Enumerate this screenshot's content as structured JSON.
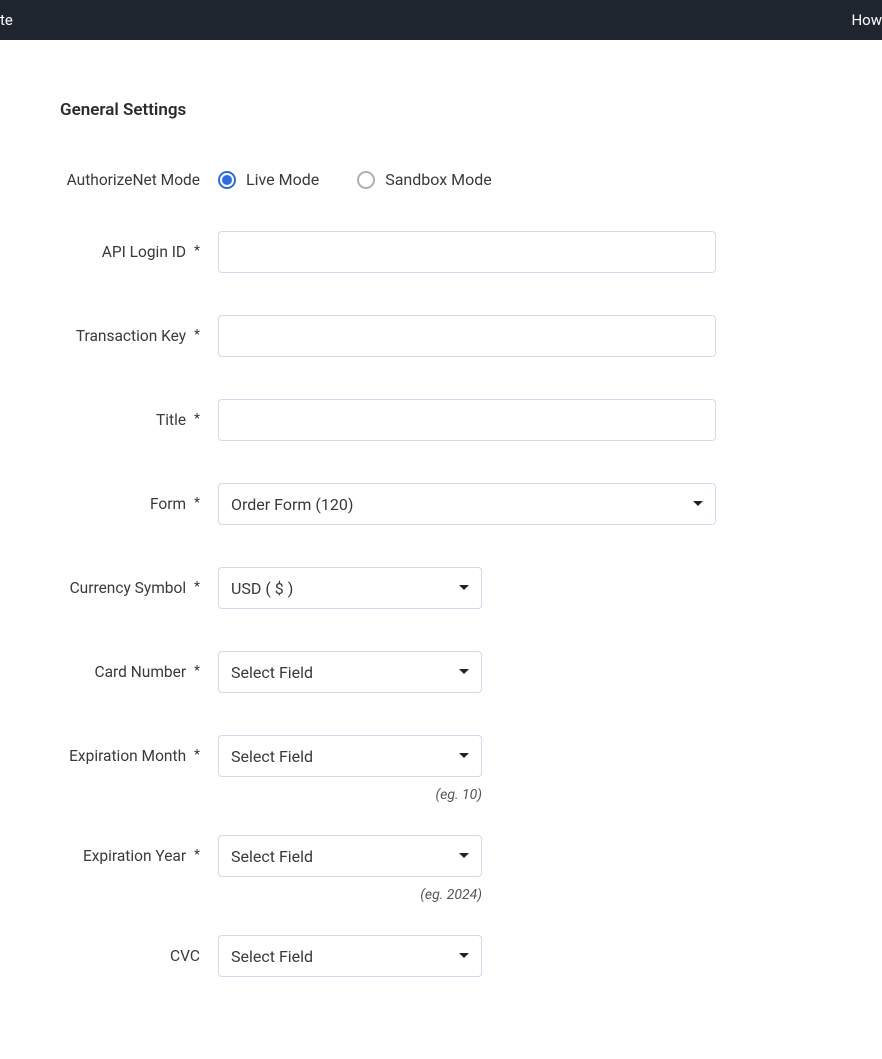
{
  "topbar": {
    "left_fragment": "te",
    "right_fragment": "How"
  },
  "section_title": "General Settings",
  "fields": {
    "mode": {
      "label": "AuthorizeNet Mode",
      "options": {
        "live": "Live Mode",
        "sandbox": "Sandbox Mode"
      },
      "selected": "live"
    },
    "api_login": {
      "label": "API Login ID",
      "required": "*",
      "value": ""
    },
    "transaction_key": {
      "label": "Transaction Key",
      "required": "*",
      "value": ""
    },
    "title": {
      "label": "Title",
      "required": "*",
      "value": ""
    },
    "form": {
      "label": "Form",
      "required": "*",
      "value": "Order Form (120)"
    },
    "currency": {
      "label": "Currency Symbol",
      "required": "*",
      "value": "USD ( $ )"
    },
    "card_number": {
      "label": "Card Number",
      "required": "*",
      "value": "Select Field"
    },
    "exp_month": {
      "label": "Expiration Month",
      "required": "*",
      "value": "Select Field",
      "hint": "(eg. 10)"
    },
    "exp_year": {
      "label": "Expiration Year",
      "required": "*",
      "value": "Select Field",
      "hint": "(eg. 2024)"
    },
    "cvc": {
      "label": "CVC",
      "value": "Select Field"
    }
  }
}
